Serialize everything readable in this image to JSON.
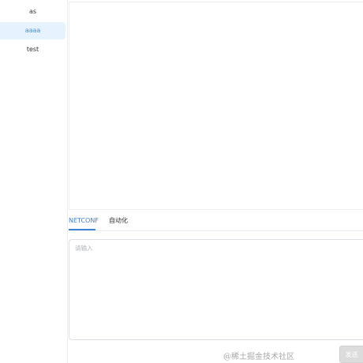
{
  "sidebar": {
    "items": [
      {
        "label": "as",
        "active": false
      },
      {
        "label": "aaaa",
        "active": true
      },
      {
        "label": "test",
        "active": false
      }
    ]
  },
  "tabs": [
    {
      "label": "NETCONF",
      "active": true
    },
    {
      "label": "自动化",
      "active": false
    }
  ],
  "editor": {
    "placeholder": "请输入",
    "value": ""
  },
  "actions": {
    "submit_label": "发送"
  },
  "watermark": {
    "text": "@稀土掘金技术社区"
  },
  "colors": {
    "accent": "#3d82d3",
    "active_item_bg": "#e6f2fd",
    "border": "#eceef2"
  }
}
